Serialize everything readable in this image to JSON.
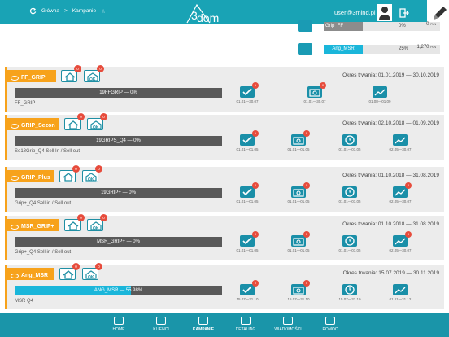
{
  "header": {
    "breadcrumb_home": "Główna",
    "breadcrumb_sep": ">",
    "breadcrumb_current": "Kampanie",
    "logo_text": "dom",
    "user": "user@3mind.pl"
  },
  "stats": [
    {
      "name": "Grip_FF",
      "percent": "0%",
      "amount": "0",
      "currency": "PLN",
      "active": false
    },
    {
      "name": "Ang_MSR",
      "percent": "25%",
      "amount": "1,270",
      "currency": "PLN",
      "active": true
    }
  ],
  "campaigns": [
    {
      "name": "FF_GRIP",
      "badge1": "0",
      "badge2": "0",
      "period": "Okres trwania: 01.01.2019 — 30.10.2019",
      "bar_label": "19FFGRIP — 0%",
      "progress": 0,
      "subtitle": "FF_GRIP",
      "actions": [
        {
          "badge": "1",
          "date": "01.01—30.07",
          "icon": "check-icon"
        },
        {
          "badge": "0",
          "date": "01.01—30.07",
          "icon": "camera-icon"
        },
        {
          "badge": "",
          "date": "01.08—01.09",
          "icon": "chart-icon"
        }
      ]
    },
    {
      "name": "GRIP_Sezon",
      "badge1": "0",
      "badge2": "0",
      "period": "Okres trwania: 02.10.2018 — 01.09.2019",
      "bar_label": "19GRIPS_Q4 — 0%",
      "progress": 0,
      "subtitle": "Se18Grip_Q4 Sell In / Sell out",
      "actions": [
        {
          "badge": "1",
          "date": "01.01—01.05",
          "icon": "check-icon"
        },
        {
          "badge": "0",
          "date": "01.01—01.05",
          "icon": "camera-icon"
        },
        {
          "badge": "",
          "date": "01.01—01.05",
          "icon": "clock-icon"
        },
        {
          "badge": "",
          "date": "02.05—30.07",
          "icon": "chart-icon"
        }
      ]
    },
    {
      "name": "GRIP_Plus",
      "badge1": "0",
      "badge2": "0",
      "period": "Okres trwania: 01.10.2018 — 31.08.2019",
      "bar_label": "19GRIP+ — 0%",
      "progress": 0,
      "subtitle": "Grip+_Q4 Sell in / Sell out",
      "actions": [
        {
          "badge": "0",
          "date": "01.01—01.05",
          "icon": "check-icon"
        },
        {
          "badge": "0",
          "date": "01.01—01.05",
          "icon": "camera-icon"
        },
        {
          "badge": "",
          "date": "01.01—01.05",
          "icon": "clock-icon"
        },
        {
          "badge": "0",
          "date": "02.05—30.07",
          "icon": "chart-icon"
        }
      ]
    },
    {
      "name": "MSR_GRIP+",
      "badge1": "0",
      "badge2": "0",
      "period": "Okres trwania: 01.10.2018 — 31.08.2019",
      "bar_label": "MSR_GRIP+ — 0%",
      "progress": 0,
      "subtitle": "Grip+_Q4 Sell in / Sell out",
      "actions": [
        {
          "badge": "0",
          "date": "01.01—01.05",
          "icon": "check-icon"
        },
        {
          "badge": "0",
          "date": "01.01—01.05",
          "icon": "camera-icon"
        },
        {
          "badge": "",
          "date": "01.01—01.05",
          "icon": "clock-icon"
        },
        {
          "badge": "0",
          "date": "02.05—30.07",
          "icon": "chart-icon"
        }
      ]
    },
    {
      "name": "Ang_MSR",
      "badge1": "0",
      "badge2": "0",
      "period": "Okres trwania: 15.07.2019 — 30.11.2019",
      "bar_label": "ANG_MSR — 55.98%",
      "progress": 55.98,
      "subtitle": "MSR Q4",
      "actions": [
        {
          "badge": "0",
          "date": "15.07—31.10",
          "icon": "check-icon"
        },
        {
          "badge": "0",
          "date": "15.07—31.10",
          "icon": "camera-icon"
        },
        {
          "badge": "",
          "date": "15.07—31.10",
          "icon": "clock-icon"
        },
        {
          "badge": "",
          "date": "01.11—31.12",
          "icon": "chart-icon"
        }
      ]
    }
  ],
  "nav": [
    {
      "label": "HOME",
      "active": false
    },
    {
      "label": "KLIENCI",
      "active": false
    },
    {
      "label": "KAMPANIE",
      "active": true
    },
    {
      "label": "DETALING",
      "active": false
    },
    {
      "label": "WIADOMOŚCI",
      "active": false
    },
    {
      "label": "POMOC",
      "active": false
    }
  ]
}
